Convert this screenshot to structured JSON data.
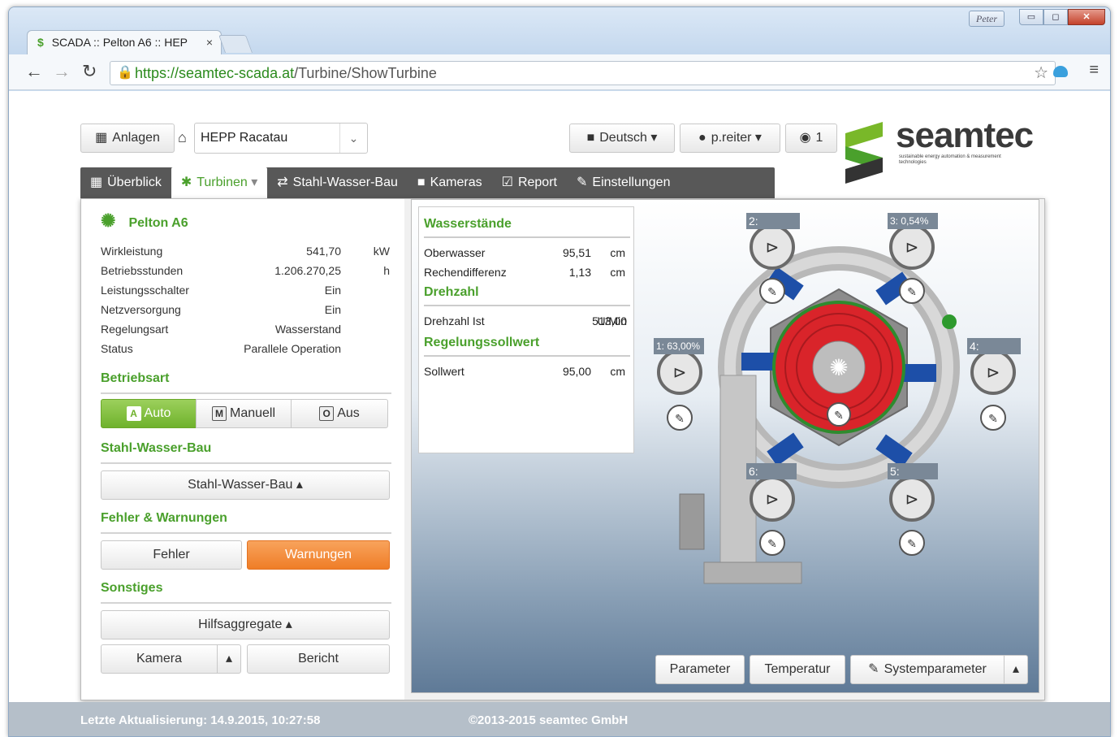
{
  "browser": {
    "user_badge": "Peter",
    "min_label": "▭",
    "max_label": "◻",
    "close_label": "✕",
    "tab_title": "SCADA :: Pelton A6 :: HEP",
    "tab_close": "×",
    "url_secure": "https://seamtec-scada.at",
    "url_path": "/Turbine/ShowTurbine"
  },
  "top": {
    "anlagen_label": "Anlagen",
    "plant_select": "HEPP Racatau",
    "language_label": "Deutsch",
    "user_label": "p.reiter",
    "notification_count": "1"
  },
  "logo": {
    "text": "seamtec",
    "tagline": "sustainable energy automation & measurement technologies"
  },
  "nav": {
    "items": [
      {
        "label": "Überblick",
        "icon": "grid-icon"
      },
      {
        "label": "Turbinen",
        "icon": "gear-icon"
      },
      {
        "label": "Stahl-Wasser-Bau",
        "icon": "swap-icon"
      },
      {
        "label": "Kameras",
        "icon": "camera-icon"
      },
      {
        "label": "Report",
        "icon": "check-icon"
      },
      {
        "label": "Einstellungen",
        "icon": "wrench-icon"
      }
    ]
  },
  "turbine": {
    "name": "Pelton A6",
    "rows": [
      {
        "key": "Wirkleistung",
        "value": "541,70",
        "unit": "kW"
      },
      {
        "key": "Betriebsstunden",
        "value": "1.206.270,25",
        "unit": "h"
      },
      {
        "key": "Leistungsschalter",
        "value": "Ein",
        "unit": ""
      },
      {
        "key": "Netzversorgung",
        "value": "Ein",
        "unit": ""
      },
      {
        "key": "Regelungsart",
        "value": "Wasserstand",
        "unit": ""
      },
      {
        "key": "Status",
        "value": "Parallele Operation",
        "unit": ""
      }
    ]
  },
  "betriebsart": {
    "title": "Betriebsart",
    "auto": "Auto",
    "manuell": "Manuell",
    "aus": "Aus",
    "auto_glyph": "A",
    "manuell_glyph": "M",
    "aus_glyph": "O"
  },
  "stahl": {
    "title": "Stahl-Wasser-Bau",
    "button": "Stahl-Wasser-Bau ▴"
  },
  "fehler": {
    "title": "Fehler & Warnungen",
    "fehler_btn": "Fehler",
    "warn_btn": "Warnungen"
  },
  "sonstiges": {
    "title": "Sonstiges",
    "hilfs_btn": "Hilfsaggregate ▴",
    "kamera_btn": "Kamera",
    "bericht_btn": "Bericht"
  },
  "levels": {
    "wasser_title": "Wasserstände",
    "oberwasser": {
      "key": "Oberwasser",
      "value": "95,51",
      "unit": "cm"
    },
    "rechen": {
      "key": "Rechendifferenz",
      "value": "1,13",
      "unit": "cm"
    },
    "drehzahl_title": "Drehzahl",
    "drehzahl": {
      "key": "Drehzahl Ist",
      "value": "513,00",
      "unit": "U/Min"
    },
    "regel_title": "Regelungssollwert",
    "sollwert": {
      "key": "Sollwert",
      "value": "95,00",
      "unit": "cm"
    }
  },
  "nozzles": [
    {
      "label": "1:",
      "value": "63,00%"
    },
    {
      "label": "2:",
      "value": ""
    },
    {
      "label": "3:",
      "value": "0,54%"
    },
    {
      "label": "4:",
      "value": ""
    },
    {
      "label": "5:",
      "value": ""
    },
    {
      "label": "6:",
      "value": ""
    }
  ],
  "bottom_buttons": {
    "parameter": "Parameter",
    "temperatur": "Temperatur",
    "systemparameter": "Systemparameter"
  },
  "footer": {
    "updated": "Letzte Aktualisierung: 14.9.2015, 10:27:58",
    "copyright": "©2013-2015 seamtec GmbH"
  },
  "colors": {
    "accent_green": "#4aa02c",
    "warning_orange": "#ef7d27",
    "nav_gray": "#585858",
    "rotor_red": "#d9242a"
  }
}
